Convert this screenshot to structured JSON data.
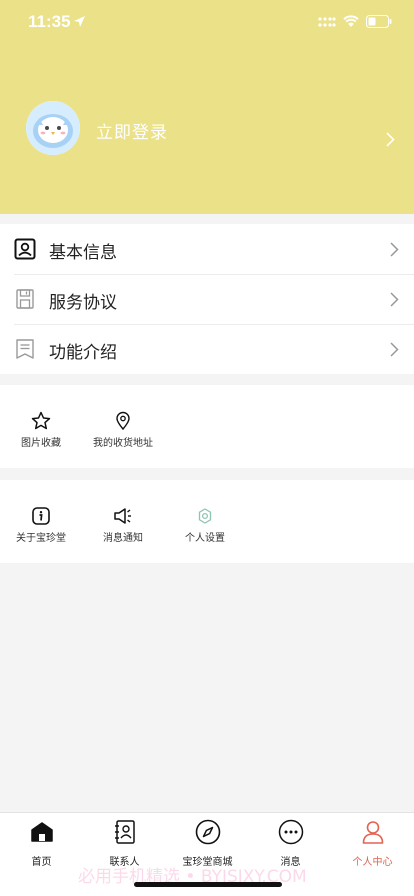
{
  "status_bar": {
    "time": "11:35"
  },
  "header": {
    "login_text": "立即登录"
  },
  "menu": {
    "items": [
      {
        "label": "基本信息",
        "icon": "user-card-icon"
      },
      {
        "label": "服务协议",
        "icon": "floppy-disk-icon"
      },
      {
        "label": "功能介绍",
        "icon": "bookmark-doc-icon"
      }
    ]
  },
  "grid1": {
    "items": [
      {
        "label": "图片收藏",
        "icon": "star-icon"
      },
      {
        "label": "我的收货地址",
        "icon": "location-pin-icon"
      }
    ]
  },
  "grid2": {
    "items": [
      {
        "label": "关于宝珍堂",
        "icon": "info-icon"
      },
      {
        "label": "消息通知",
        "icon": "megaphone-icon"
      },
      {
        "label": "个人设置",
        "icon": "gear-icon"
      }
    ]
  },
  "tabbar": {
    "tabs": [
      {
        "label": "首页",
        "icon": "home-icon"
      },
      {
        "label": "联系人",
        "icon": "contacts-icon"
      },
      {
        "label": "宝珍堂商城",
        "icon": "compass-icon"
      },
      {
        "label": "消息",
        "icon": "chat-icon"
      },
      {
        "label": "个人中心",
        "icon": "person-icon"
      }
    ],
    "active_color": "#e26450"
  },
  "watermark": "必用手机精选 • BYJSJXY.COM",
  "colors": {
    "header_bg": "#ebe189",
    "page_bg": "#f4f4f4",
    "accent": "#e26450"
  }
}
